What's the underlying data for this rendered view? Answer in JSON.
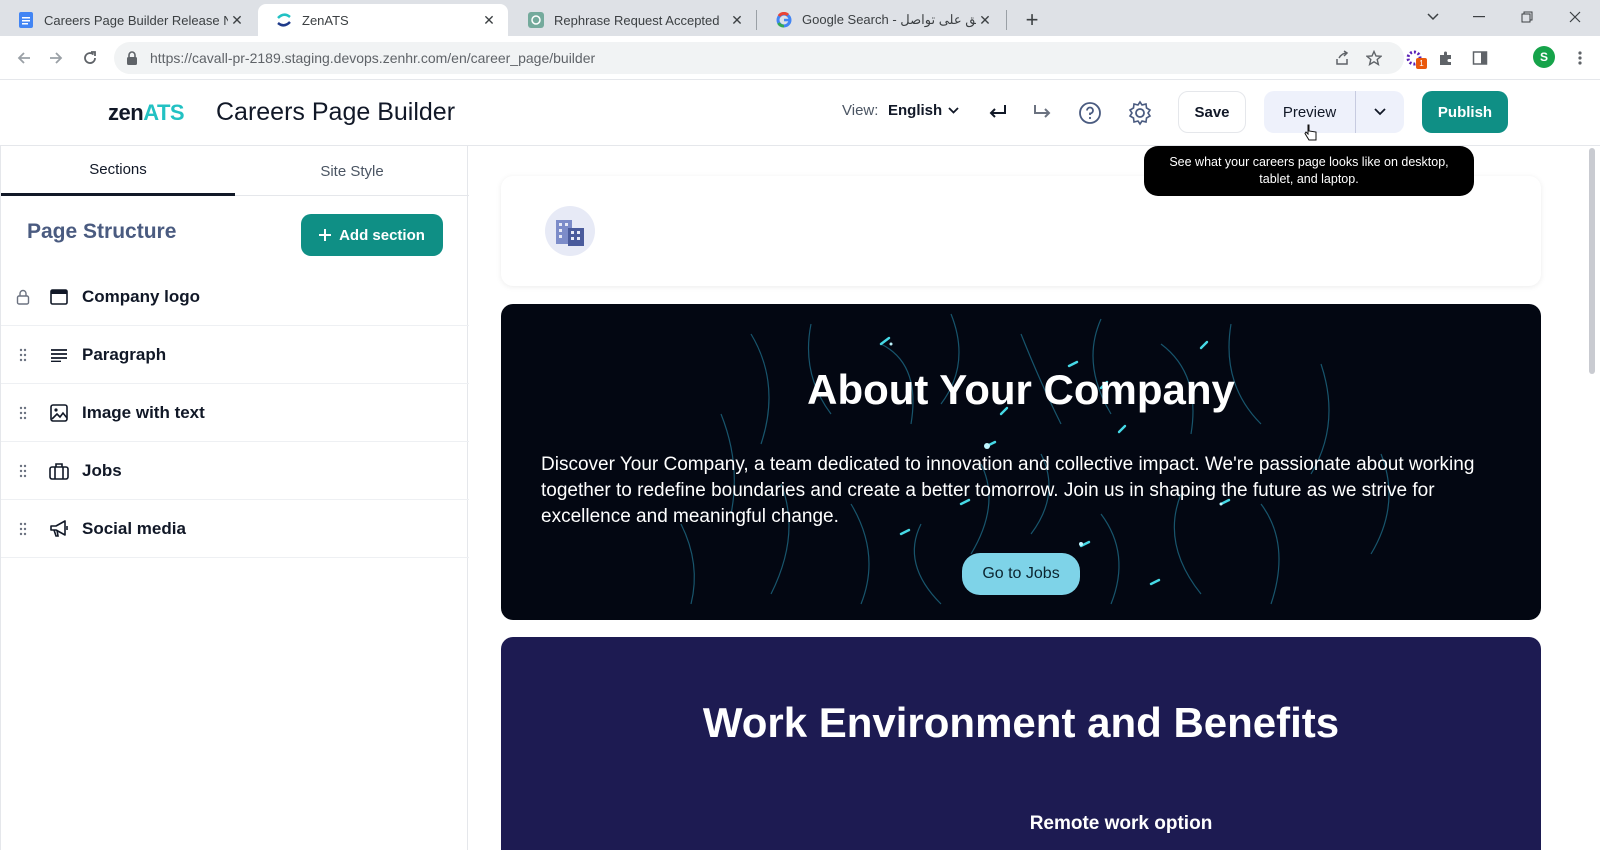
{
  "browser": {
    "tabs": [
      {
        "title": "Careers Page Builder Release No",
        "icon": "google-docs-icon"
      },
      {
        "title": "ZenATS",
        "icon": "zenats-icon"
      },
      {
        "title": "Rephrase Request Accepted",
        "icon": "chatgpt-icon"
      },
      {
        "title": "Google Search - لنبق على تواصل",
        "icon": "google-icon"
      }
    ],
    "url": "https://cavall-pr-2189.staging.devops.zenhr.com/en/career_page/builder",
    "profile_initial": "S",
    "extension_badge": "1"
  },
  "header": {
    "logo_part1": "zen",
    "logo_part2": "ATS",
    "title": "Careers Page Builder",
    "view_label": "View:",
    "view_value": "English",
    "save_label": "Save",
    "preview_label": "Preview",
    "publish_label": "Publish",
    "tooltip": "See what your careers page looks like on desktop, tablet, and laptop."
  },
  "sidebar": {
    "tabs": [
      "Sections",
      "Site Style"
    ],
    "structure_title": "Page Structure",
    "add_section_label": "Add section",
    "items": [
      {
        "label": "Company logo",
        "icon": "browser-window-icon",
        "locked": true
      },
      {
        "label": "Paragraph",
        "icon": "paragraph-icon",
        "locked": false
      },
      {
        "label": "Image with text",
        "icon": "image-icon",
        "locked": false
      },
      {
        "label": "Jobs",
        "icon": "briefcase-icon",
        "locked": false
      },
      {
        "label": "Social media",
        "icon": "megaphone-icon",
        "locked": false
      }
    ]
  },
  "canvas": {
    "about_title": "About Your Company",
    "about_body": "Discover Your Company, a team dedicated to innovation and collective impact. We're passionate about working together to redefine boundaries and create a better tomorrow. Join us in shaping the future as we strive for excellence and meaningful change.",
    "jobs_button": "Go to Jobs",
    "work_title": "Work Environment and Benefits",
    "work_subtitle": "Remote work option"
  },
  "colors": {
    "primary": "#0f8f85",
    "hero_bg": "#030712",
    "work_bg": "#1d1b52",
    "jobs_button": "#7ed3e8"
  }
}
